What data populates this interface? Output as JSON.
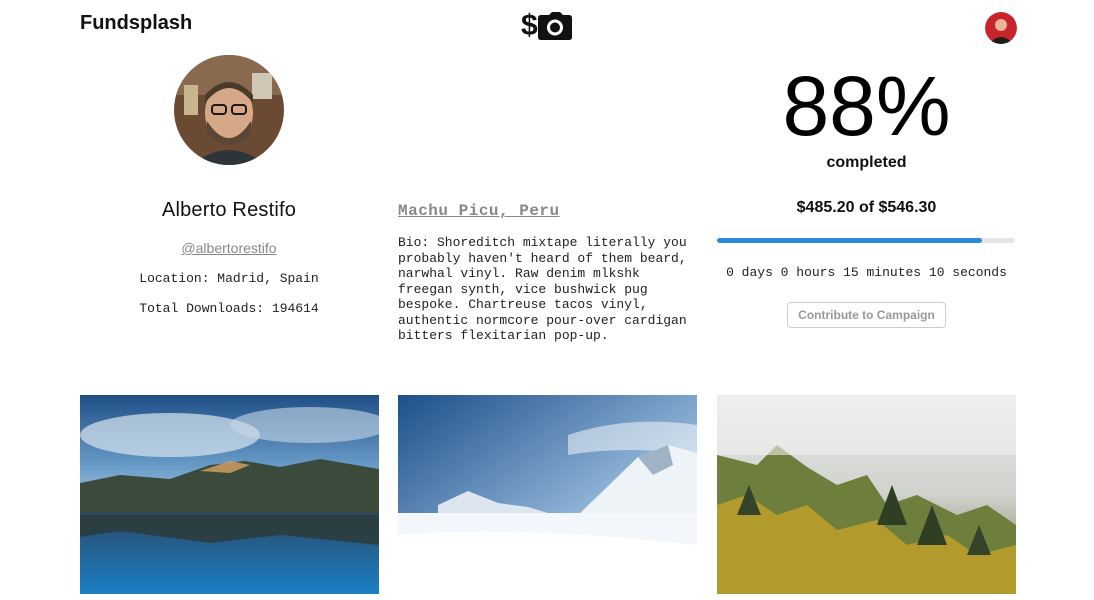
{
  "header": {
    "brand": "Fundsplash",
    "logo_symbol": "$",
    "logo_icon": "camera-icon",
    "user_avatar": "avatar"
  },
  "profile": {
    "name": "Alberto Restifo",
    "handle": "@albertorestifo",
    "location": "Location: Madrid, Spain",
    "downloads": "Total Downloads: 194614"
  },
  "campaign": {
    "place": "Machu Picu, Peru",
    "bio": "Bio: Shoreditch mixtape literally you probably haven't heard of them beard, narwhal vinyl. Raw denim mlkshk freegan synth, vice bushwick pug bespoke. Chartreuse tacos vinyl, authentic normcore pour-over cardigan bitters flexitarian pop-up."
  },
  "funding": {
    "percent_label": "88%",
    "completed_label": "completed",
    "amount_label": "$485.20 of $546.30",
    "progress_fraction": 0.888,
    "countdown": "0 days 0 hours 15 minutes 10 seconds",
    "cta_label": "Contribute to Campaign",
    "accent_color": "#2d8ad8"
  },
  "gallery": {
    "photos": [
      "mountain-lake-photo",
      "snowy-mountain-photo",
      "misty-forest-photo"
    ]
  }
}
